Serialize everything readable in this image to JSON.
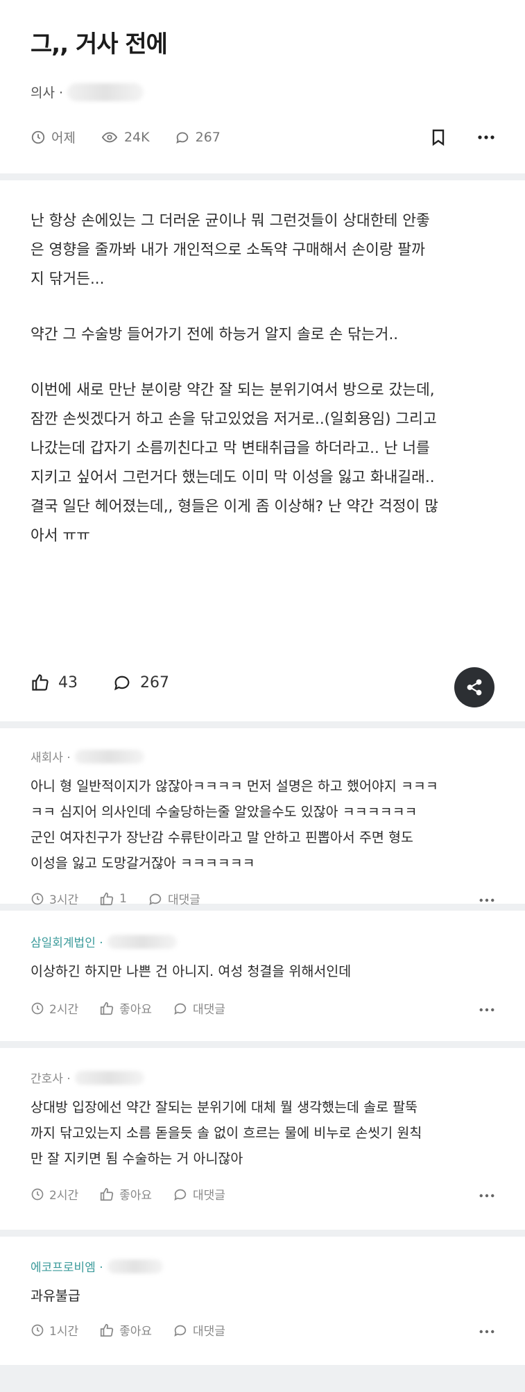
{
  "post": {
    "title": "그,, 거사 전에",
    "author_label": "의사 ·",
    "time": "어제",
    "views": "24K",
    "comments": "267",
    "body": [
      "난 항상 손에있는 그 더러운 균이나 뭐 그런것들이 상대한테 안좋\n은 영향을 줄까봐 내가 개인적으로 소독약 구매해서 손이랑 팔까\n지 닦거든...",
      "약간 그 수술방 들어가기 전에 하능거 알지 솔로 손 닦는거..",
      "이번에 새로 만난 분이랑 약간 잘 되는 분위기여서 방으로 갔는데,\n잠깐 손씻겠다거 하고 손을 닦고있었음 저거로..(일회용임) 그리고\n나갔는데 갑자기 소름끼친다고 막 변태취급을 하더라고.. 난 너를\n지키고 싶어서 그런거다 했는데도 이미 막 이성을 잃고 화내길래..\n결국 일단 헤어졌는데,, 형들은 이게 좀 이상해? 난 약간 걱정이 많\n아서 ㅠㅠ"
    ],
    "likes": "43",
    "comment_count": "267"
  },
  "comments": [
    {
      "author": "새회사 ·",
      "text": "아니 형 일반적이지가 않잖아ㅋㅋㅋㅋ 먼저 설명은 하고 했어야지 ㅋㅋㅋ\nㅋㅋ 심지어 의사인데 수술당하는줄 알았을수도 있잖아 ㅋㅋㅋㅋㅋㅋ\n군인 여자친구가 장난감 수류탄이라고 말 안하고 핀뽑아서 주면 형도\n이성을 잃고 도망갈거잖아 ㅋㅋㅋㅋㅋㅋ",
      "time": "3시간",
      "likes": "1",
      "reply": "대댓글"
    },
    {
      "author": "삼일회계법인 ·",
      "text": "이상하긴 하지만 나쁜 건 아니지. 여성 청결을 위해서인데",
      "time": "2시간",
      "likes": "좋아요",
      "reply": "대댓글"
    },
    {
      "author": "간호사 ·",
      "text": "상대방 입장에선 약간 잘되는 분위기에 대체 뭘 생각했는데 솔로 팔뚝\n까지 닦고있는지 소름 돋을듯 솔 없이 흐르는 물에 비누로 손씻기 원칙\n만 잘 지키면 됨 수술하는 거 아니잖아",
      "time": "2시간",
      "likes": "좋아요",
      "reply": "대댓글"
    },
    {
      "author": "에코프로비엠 ·",
      "text": "과유불급",
      "time": "1시간",
      "likes": "좋아요",
      "reply": "대댓글"
    }
  ],
  "icons": {
    "clock": "clock-icon",
    "eye": "eye-icon",
    "comment": "comment-icon",
    "bookmark": "bookmark-icon",
    "more": "more-icon",
    "thumb": "thumbs-up-icon",
    "share": "share-icon"
  },
  "colors": {
    "accent_author": "#3a9a9a",
    "share_button": "#2c2f33"
  }
}
